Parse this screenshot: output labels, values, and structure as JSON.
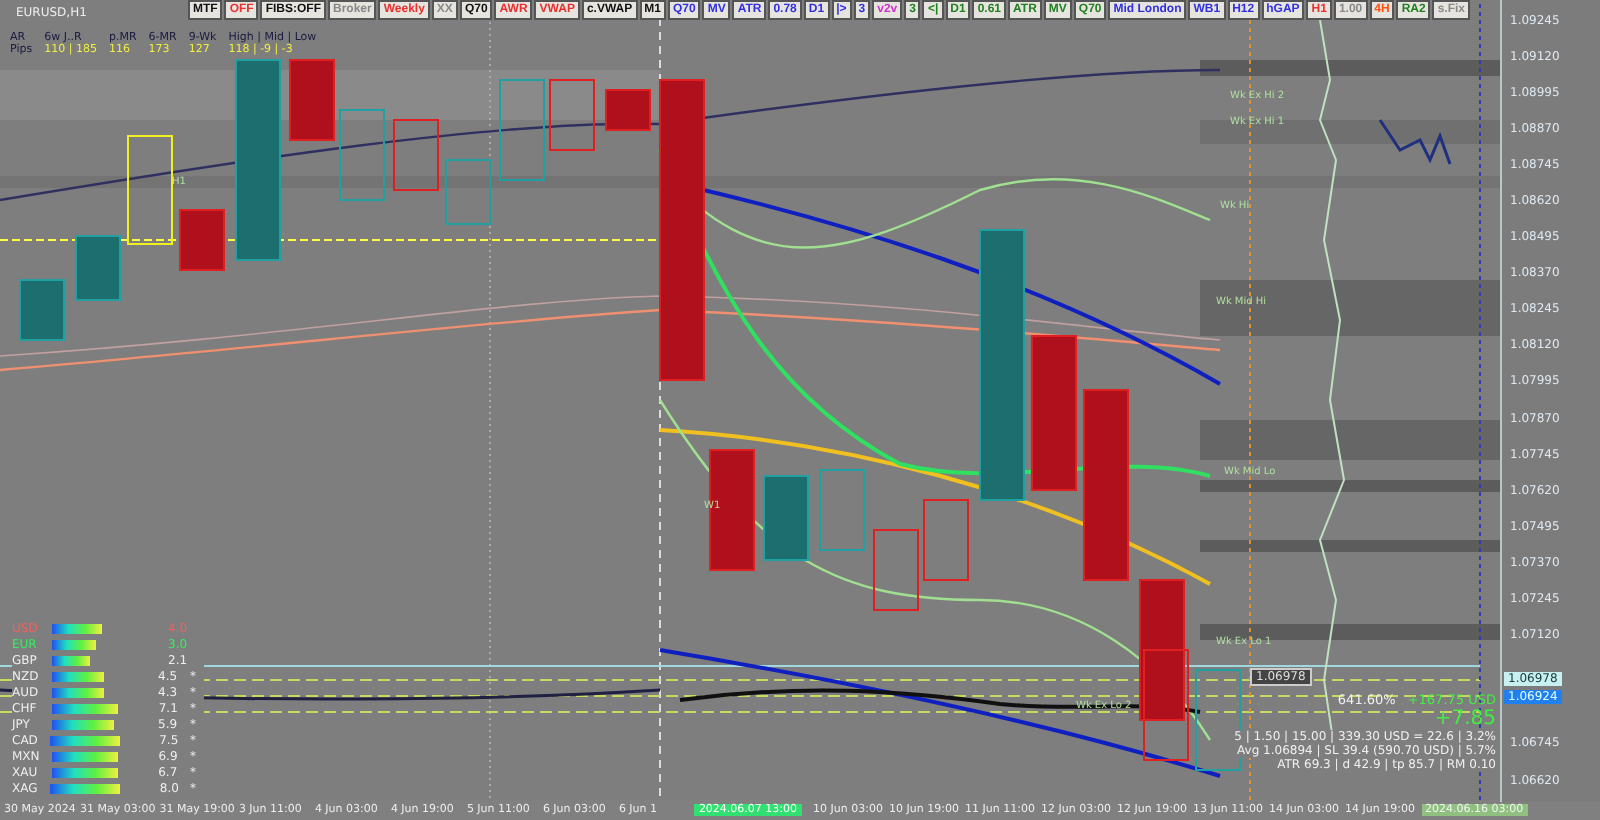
{
  "chart": {
    "symbol": "EURUSD,H1"
  },
  "toolbar": [
    {
      "label": "MTF",
      "color": "#111111"
    },
    {
      "label": "OFF",
      "color": "#e83030"
    },
    {
      "label": "FIBS:OFF",
      "color": "#111111"
    },
    {
      "label": "Broker",
      "color": "#888888"
    },
    {
      "label": "Weekly",
      "color": "#e83030"
    },
    {
      "label": "XX",
      "color": "#888888"
    },
    {
      "label": "Q70",
      "color": "#111111"
    },
    {
      "label": "AWR",
      "color": "#e83030"
    },
    {
      "label": "VWAP",
      "color": "#e83030"
    },
    {
      "label": "c.VWAP",
      "color": "#111111"
    },
    {
      "label": "M1",
      "color": "#111111"
    },
    {
      "label": "Q70",
      "color": "#3030e0"
    },
    {
      "label": "MV",
      "color": "#3030e0"
    },
    {
      "label": "ATR",
      "color": "#3030e0"
    },
    {
      "label": "0.78",
      "color": "#3030e0"
    },
    {
      "label": "D1",
      "color": "#3030e0"
    },
    {
      "label": "|>",
      "color": "#3030e0"
    },
    {
      "label": "3",
      "color": "#3030e0"
    },
    {
      "label": "v2v",
      "color": "#d030d0"
    },
    {
      "label": "3",
      "color": "#208020"
    },
    {
      "label": "<|",
      "color": "#208020"
    },
    {
      "label": "D1",
      "color": "#208020"
    },
    {
      "label": "0.61",
      "color": "#208020"
    },
    {
      "label": "ATR",
      "color": "#208020"
    },
    {
      "label": "MV",
      "color": "#208020"
    },
    {
      "label": "Q70",
      "color": "#208020"
    },
    {
      "label": "Mid London",
      "color": "#3030e0"
    },
    {
      "label": "WB1",
      "color": "#3030e0"
    },
    {
      "label": "H12",
      "color": "#3030e0"
    },
    {
      "label": "hGAP",
      "color": "#3030e0"
    },
    {
      "label": "H1",
      "color": "#e83030"
    },
    {
      "label": "1.00",
      "color": "#888888"
    },
    {
      "label": "4H",
      "color": "#ff5010"
    },
    {
      "label": "RA2",
      "color": "#208020"
    },
    {
      "label": "s.Fix",
      "color": "#888888"
    }
  ],
  "stats": {
    "row_labels": [
      "AR",
      "Pips"
    ],
    "columns": [
      {
        "heading": "6w J..R",
        "value": "110 | 185"
      },
      {
        "heading": "p.MR",
        "value": "116"
      },
      {
        "heading": "6-MR",
        "value": "173"
      },
      {
        "heading": "9-Wk",
        "value": "127"
      },
      {
        "heading": "High | Mid | Low",
        "value": "118 | -9 | -3"
      }
    ]
  },
  "currency_strength": [
    {
      "code": "USD",
      "color": "#f06060",
      "value": "4.0"
    },
    {
      "code": "EUR",
      "color": "#30f060",
      "value": "3.0"
    },
    {
      "code": "GBP",
      "color": "#eeeeee",
      "value": "2.1"
    },
    {
      "code": "NZD",
      "color": "#eeeeee",
      "value": "4.5",
      "mark": "*"
    },
    {
      "code": "AUD",
      "color": "#eeeeee",
      "value": "4.3",
      "mark": "*"
    },
    {
      "code": "CHF",
      "color": "#eeeeee",
      "value": "7.1",
      "mark": "*"
    },
    {
      "code": "JPY",
      "color": "#eeeeee",
      "value": "5.9",
      "mark": "*"
    },
    {
      "code": "CAD",
      "color": "#eeeeee",
      "value": "7.5",
      "mark": "*"
    },
    {
      "code": "MXN",
      "color": "#eeeeee",
      "value": "6.9",
      "mark": "*"
    },
    {
      "code": "XAU",
      "color": "#eeeeee",
      "value": "6.7",
      "mark": "*"
    },
    {
      "code": "XAG",
      "color": "#eeeeee",
      "value": "8.0",
      "mark": "*"
    }
  ],
  "chart_labels": [
    "Wk Ex Hi 2",
    "Wk Ex Hi 1",
    "Wk Hi",
    "Wk Mid Hi",
    "Wk Mid Lo",
    "Wk Ex Lo 1",
    "Wk Ex Lo 2",
    "H1",
    "W1"
  ],
  "price_axis": {
    "ticks": [
      "1.09245",
      "1.09120",
      "1.08995",
      "1.08870",
      "1.08745",
      "1.08620",
      "1.08495",
      "1.08370",
      "1.08245",
      "1.08120",
      "1.07995",
      "1.07870",
      "1.07745",
      "1.07620",
      "1.07495",
      "1.07370",
      "1.07245",
      "1.07120",
      "1.06745",
      "1.06620"
    ],
    "current_price": "1.06978",
    "bid_price": "1.06924",
    "line_price": "1.06978"
  },
  "time_axis": {
    "labels": [
      "30 May 2024",
      "31 May 03:00",
      "31 May 19:00",
      "3 Jun 11:00",
      "4 Jun 03:00",
      "4 Jun 19:00",
      "5 Jun 11:00",
      "6 Jun 03:00",
      "6 Jun 1",
      "10 Jun 03:00",
      "10 Jun 19:00",
      "11 Jun 11:00",
      "12 Jun 03:00",
      "12 Jun 19:00",
      "13 Jun 11:00",
      "14 Jun 03:00",
      "14 Jun 19:00"
    ],
    "cursor_time": "2024.06.07 13:00",
    "end_time": "2024.06.16 03:00"
  },
  "position_info": {
    "percent": "641.60%",
    "profit": "+167.75 USD",
    "pips": "+7.85",
    "lines": [
      "5 | 1.50 | 15.00 | 339.30 USD = 22.6 | 3.2%",
      "Avg 1.06894 | SL 39.4 (590.70 USD) | 5.7%",
      "ATR 69.3 | d 42.9 | tp 85.7 | RM 0.10"
    ]
  }
}
